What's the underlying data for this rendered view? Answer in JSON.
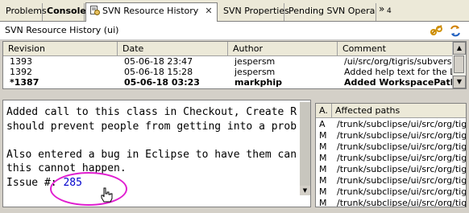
{
  "tabs": [
    {
      "label": "Problems",
      "active": false
    },
    {
      "label": "Console",
      "active": false
    },
    {
      "label": "SVN Resource History",
      "active": true
    },
    {
      "label": "SVN Properties",
      "active": false
    },
    {
      "label": "Pending SVN Opera...",
      "active": false
    }
  ],
  "overflow": {
    "count": "4"
  },
  "view_title": "SVN Resource History (ui)",
  "table": {
    "columns": [
      "Revision",
      "Date",
      "Author",
      "Comment"
    ],
    "rows": [
      {
        "revision": "1393",
        "date": "05-06-18 23:47",
        "author": "jespersm",
        "comment": "/ui/src/org/tigris/subversion/",
        "selected": false
      },
      {
        "revision": "1392",
        "date": "05-06-18 15:28",
        "author": "jespersm",
        "comment": "Added help text for the Lock",
        "selected": false
      },
      {
        "revision": "*1387",
        "date": "05-06-18 03:23",
        "author": "markphip",
        "comment": "Added WorkspacePathVa",
        "selected": true
      }
    ]
  },
  "comment_text": {
    "line1": "Added call to this class in Checkout, Create R",
    "line2": "should prevent people from getting into a prob",
    "line3": "",
    "line4": "Also entered a bug in Eclipse to have them can",
    "line5": "this cannot happen.",
    "issue_label": "Issue #: ",
    "issue_number": "285"
  },
  "affected": {
    "col_action": "A.",
    "col_paths": "Affected paths",
    "rows": [
      {
        "action": "A",
        "path": "/trunk/subclipse/ui/src/org/tig..."
      },
      {
        "action": "M",
        "path": "/trunk/subclipse/ui/src/org/tig..."
      },
      {
        "action": "M",
        "path": "/trunk/subclipse/ui/src/org/tig..."
      },
      {
        "action": "M",
        "path": "/trunk/subclipse/ui/src/org/tig..."
      },
      {
        "action": "M",
        "path": "/trunk/subclipse/ui/src/org/tig..."
      },
      {
        "action": "M",
        "path": "/trunk/subclipse/ui/src/org/tig..."
      },
      {
        "action": "M",
        "path": "/trunk/subclipse/ui/src/org/tig..."
      },
      {
        "action": "M",
        "path": "/trunk/subclipse/ui/src/org/tig..."
      }
    ]
  },
  "icons": {
    "tab_history": "svn-history-icon",
    "close": "close-icon",
    "link": "link-with-editor-icon",
    "refresh": "refresh-icon",
    "cursor": "hand-cursor-icon"
  },
  "colors": {
    "annotation": "#e01ed0",
    "link": "#0000cc"
  }
}
